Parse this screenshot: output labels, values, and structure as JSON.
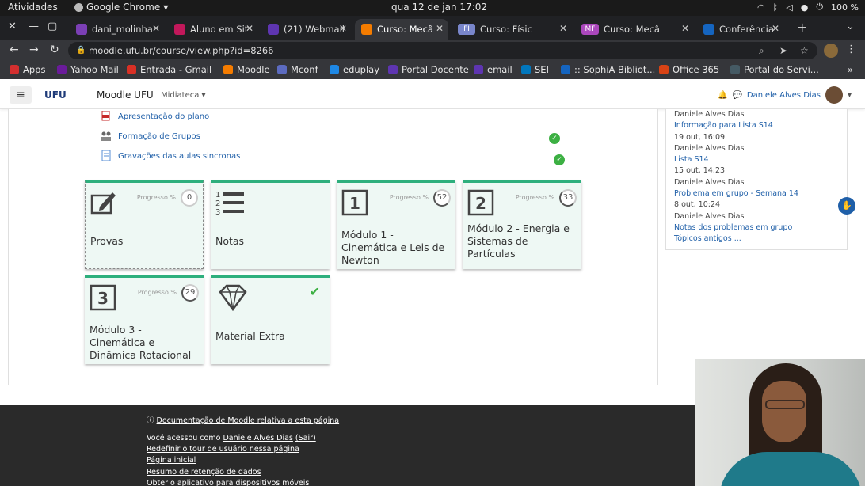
{
  "os": {
    "activities": "Atividades",
    "app": "Google Chrome",
    "clock": "qua 12 de jan  17:02",
    "battery": "100 %"
  },
  "tabs": [
    {
      "label": "dani_molinha",
      "fav_color": "#7b3fb5"
    },
    {
      "label": "Aluno em Sit",
      "fav_color": "#c2185b"
    },
    {
      "label": "(21) Webmail",
      "fav_color": "#5e35b1"
    },
    {
      "label": "Curso: Mecâ",
      "fav_color": "#f57c00",
      "active": true
    },
    {
      "label": "Curso: Físic",
      "fav_color": "#7986cb",
      "badge": "FI"
    },
    {
      "label": "Curso: Mecâ",
      "fav_color": "#ab47bc",
      "badge": "MF"
    },
    {
      "label": "Conferência",
      "fav_color": "#1565c0"
    }
  ],
  "address": {
    "url": "moodle.ufu.br/course/view.php?id=8266"
  },
  "bookmarks": [
    {
      "label": "Apps",
      "fav_color": "#d32f2f"
    },
    {
      "label": "Yahoo Mail",
      "fav_color": "#6a1b9a"
    },
    {
      "label": "Entrada - Gmail",
      "fav_color": "#d93025"
    },
    {
      "label": "Moodle",
      "fav_color": "#f57c00"
    },
    {
      "label": "Mconf",
      "fav_color": "#5c6bc0"
    },
    {
      "label": "eduplay",
      "fav_color": "#1e88e5"
    },
    {
      "label": "Portal Docente",
      "fav_color": "#5e35b1"
    },
    {
      "label": "email",
      "fav_color": "#5e35b1"
    },
    {
      "label": "SEI",
      "fav_color": "#0277bd"
    },
    {
      "label": ":: SophiA Bibliot...",
      "fav_color": "#1565c0"
    },
    {
      "label": "Office 365",
      "fav_color": "#d84315"
    },
    {
      "label": "Portal do Servi...",
      "fav_color": "#455a64"
    }
  ],
  "moodle": {
    "logo": "UFU",
    "site_name": "Moodle UFU",
    "menu": "Midiateca",
    "user": "Daniele Alves Dias"
  },
  "activities": [
    {
      "label": "Apresentação do plano",
      "icon": "pdf-icon",
      "done": false
    },
    {
      "label": "Formação de Grupos",
      "icon": "group-icon",
      "done": true
    },
    {
      "label": "Gravações das aulas sincronas",
      "icon": "page-icon",
      "done": true
    }
  ],
  "progress_label": "Progresso %",
  "tiles": [
    {
      "name": "Provas",
      "icon": "pencil-icon",
      "progress": "0",
      "pct": 0
    },
    {
      "name": "Notas",
      "icon": "list-icon",
      "progress": null
    },
    {
      "name": "Módulo 1 - Cinemática e Leis de Newton",
      "icon": "number-1-icon",
      "num": "1",
      "progress": "52",
      "pct": 52
    },
    {
      "name": "Módulo 2 - Energia e Sistemas de Partículas",
      "icon": "number-2-icon",
      "num": "2",
      "progress": "33",
      "pct": 33
    },
    {
      "name": "Módulo 3 - Cinemática e Dinâmica Rotacional",
      "icon": "number-3-icon",
      "num": "3",
      "progress": "29",
      "pct": 29
    },
    {
      "name": "Material Extra",
      "icon": "diamond-icon",
      "progress": null,
      "complete": true
    }
  ],
  "recent": [
    {
      "text": "Daniele Alves Dias",
      "type": "meta"
    },
    {
      "text": "Informação para Lista S14",
      "type": "link"
    },
    {
      "text": "19 out, 16:09",
      "type": "meta"
    },
    {
      "text": "Daniele Alves Dias",
      "type": "meta"
    },
    {
      "text": "Lista S14",
      "type": "link"
    },
    {
      "text": "15 out, 14:23",
      "type": "meta"
    },
    {
      "text": "Daniele Alves Dias",
      "type": "meta"
    },
    {
      "text": "Problema em grupo - Semana 14",
      "type": "link"
    },
    {
      "text": "8 out, 10:24",
      "type": "meta"
    },
    {
      "text": "Daniele Alves Dias",
      "type": "meta"
    },
    {
      "text": "Notas dos problemas em grupo",
      "type": "link"
    },
    {
      "text": "Tópicos antigos ...",
      "type": "link"
    }
  ],
  "footer": {
    "docs": "Documentação de Moodle relativa a esta página",
    "access_prefix": "Você acessou como ",
    "access_user": "Daniele Alves Dias",
    "logout": "(Sair)",
    "tour": "Redefinir o tour de usuário nessa página",
    "home": "Página inicial",
    "retention": "Resumo de retenção de dados",
    "app": "Obter o aplicativo para dispositivos móveis"
  }
}
